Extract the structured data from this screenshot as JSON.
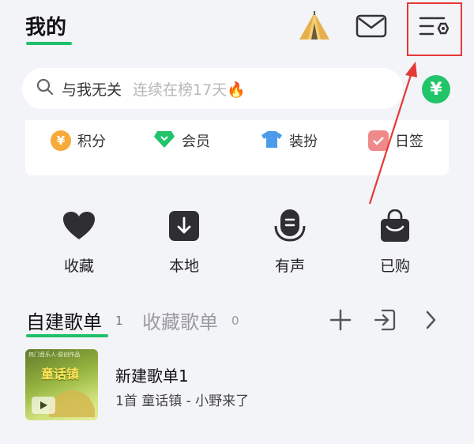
{
  "header": {
    "title": "我的",
    "icons": [
      "tent-icon",
      "mail-icon",
      "settings-menu-icon"
    ],
    "accent": "#20c06a"
  },
  "search": {
    "value": "与我无关",
    "hint": "连续在榜17天🔥",
    "yen_symbol": "¥"
  },
  "perks": [
    {
      "label": "积分",
      "icon": "points-coin-icon",
      "symbol": "¥"
    },
    {
      "label": "会员",
      "icon": "vip-diamond-icon"
    },
    {
      "label": "装扮",
      "icon": "tshirt-icon"
    },
    {
      "label": "日签",
      "icon": "daily-sign-checkbox-icon"
    }
  ],
  "quick_actions": [
    {
      "label": "收藏",
      "icon": "heart-icon"
    },
    {
      "label": "本地",
      "icon": "download-icon"
    },
    {
      "label": "有声",
      "icon": "audio-icon"
    },
    {
      "label": "已购",
      "icon": "shopping-bag-icon"
    }
  ],
  "tabs": {
    "created": {
      "label": "自建歌单",
      "count": "1"
    },
    "collected": {
      "label": "收藏歌单",
      "count": "0"
    },
    "actions": [
      "add-icon",
      "import-icon",
      "chevron-right-icon"
    ]
  },
  "playlists": [
    {
      "name": "新建歌单1",
      "meta": "1首 童话镇 - 小野来了",
      "cover_title": "童话镇",
      "cover_caption": "热门音乐人·原创作品"
    }
  ],
  "annotation": {
    "color": "#e53935"
  }
}
